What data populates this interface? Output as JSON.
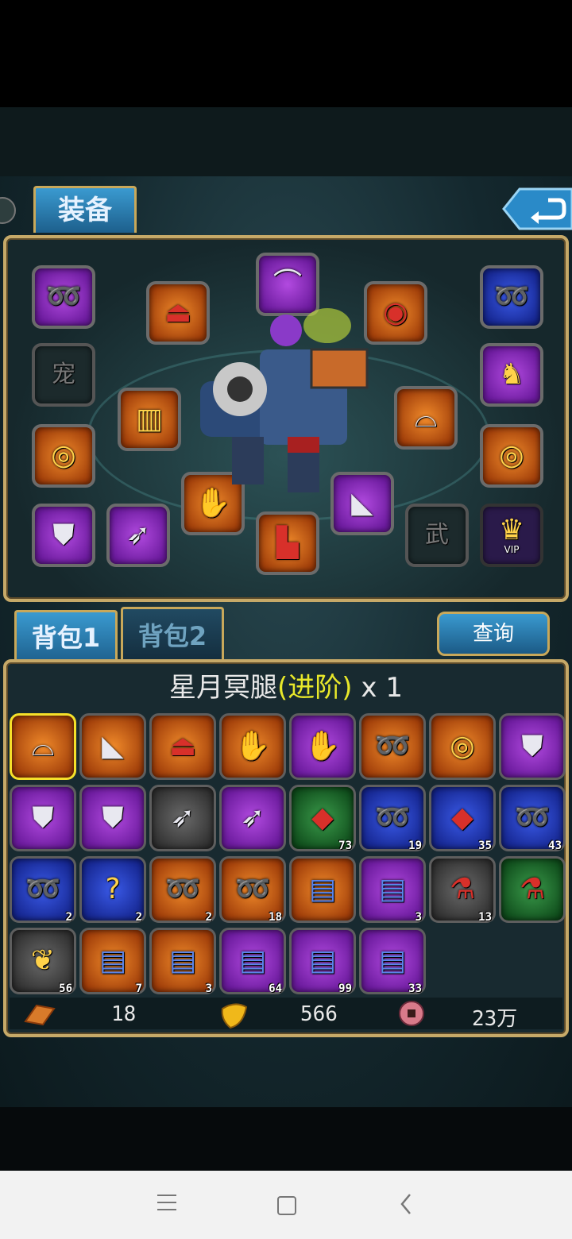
{
  "header": {
    "equip_tab": "装备",
    "back_icon": "back-arrow-icon"
  },
  "equipment_slots": [
    {
      "name": "necklace",
      "icon": "chain-amulet-icon",
      "rarity": "purple"
    },
    {
      "name": "pet",
      "label": "宠",
      "icon": "empty-slot-icon",
      "rarity": "empty"
    },
    {
      "name": "ring",
      "icon": "gold-ring-icon",
      "rarity": "orange"
    },
    {
      "name": "armor",
      "icon": "chest-armor-icon",
      "rarity": "purple"
    },
    {
      "name": "weapon",
      "icon": "spear-icon",
      "rarity": "purple"
    },
    {
      "name": "cloak",
      "icon": "red-cloak-icon",
      "rarity": "orange"
    },
    {
      "name": "bracer",
      "icon": "bracer-icon",
      "rarity": "orange"
    },
    {
      "name": "helmet",
      "icon": "winged-helm-icon",
      "rarity": "purple"
    },
    {
      "name": "gloves",
      "icon": "gauntlet-icon",
      "rarity": "orange"
    },
    {
      "name": "boots",
      "icon": "boot-icon",
      "rarity": "orange"
    },
    {
      "name": "belt",
      "icon": "belt-icon",
      "rarity": "orange"
    },
    {
      "name": "legs",
      "icon": "leg-armor-icon",
      "rarity": "orange"
    },
    {
      "name": "shoulder",
      "icon": "horn-shoulder-icon",
      "rarity": "purple"
    },
    {
      "name": "necklace2",
      "icon": "chain-amulet-icon",
      "rarity": "blue"
    },
    {
      "name": "mount",
      "icon": "horse-icon",
      "rarity": "purple"
    },
    {
      "name": "ring2",
      "icon": "gold-ring-icon",
      "rarity": "orange"
    },
    {
      "name": "weapon2",
      "label": "武",
      "icon": "empty-slot-icon",
      "rarity": "empty"
    },
    {
      "name": "vip",
      "label": "VIP",
      "icon": "crown-icon",
      "rarity": "dark"
    }
  ],
  "bag": {
    "tab1": "背包1",
    "tab2": "背包2",
    "query_button": "查询",
    "item_name": "星月冥腿",
    "item_tag": "(进阶)",
    "item_qty": "x 1",
    "rows": [
      [
        {
          "icon": "leg-armor-icon",
          "rarity": "orange",
          "count": ""
        },
        {
          "icon": "horn-shoulder-icon",
          "rarity": "orange",
          "count": ""
        },
        {
          "icon": "red-cloak-icon",
          "rarity": "orange",
          "count": ""
        },
        {
          "icon": "gauntlet-icon",
          "rarity": "orange",
          "count": ""
        },
        {
          "icon": "gauntlet-icon",
          "rarity": "purple",
          "count": ""
        },
        {
          "icon": "chain-amulet-icon",
          "rarity": "orange",
          "count": ""
        },
        {
          "icon": "gold-ring-icon",
          "rarity": "orange",
          "count": ""
        },
        {
          "icon": "chest-armor-icon",
          "rarity": "purple",
          "count": ""
        }
      ],
      [
        {
          "icon": "chest-armor-icon",
          "rarity": "purple",
          "count": ""
        },
        {
          "icon": "chest-armor-icon",
          "rarity": "purple",
          "count": ""
        },
        {
          "icon": "spear-icon",
          "rarity": "gray",
          "count": ""
        },
        {
          "icon": "spear-icon",
          "rarity": "purple",
          "count": ""
        },
        {
          "icon": "red-gem-icon",
          "rarity": "green",
          "count": "73"
        },
        {
          "icon": "chain-amulet-icon",
          "rarity": "blue",
          "count": "19"
        },
        {
          "icon": "red-gem-icon",
          "rarity": "blue",
          "count": "35"
        },
        {
          "icon": "chain-amulet-icon",
          "rarity": "blue",
          "count": "43"
        }
      ],
      [
        {
          "icon": "chain-amulet-icon",
          "rarity": "blue",
          "count": "2"
        },
        {
          "icon": "question-mark-icon",
          "rarity": "blue",
          "count": "2"
        },
        {
          "icon": "chain-amulet-icon",
          "rarity": "orange",
          "count": "2"
        },
        {
          "icon": "chain-amulet-icon",
          "rarity": "orange",
          "count": "18"
        },
        {
          "icon": "blue-book-icon",
          "rarity": "orange",
          "count": ""
        },
        {
          "icon": "blue-book-icon",
          "rarity": "purple",
          "count": "3"
        },
        {
          "icon": "red-potion-icon",
          "rarity": "gray",
          "count": "13"
        },
        {
          "icon": "red-potion-icon",
          "rarity": "green",
          "count": ""
        }
      ],
      [
        {
          "icon": "herb-icon",
          "rarity": "gray",
          "count": "56"
        },
        {
          "icon": "blue-book-icon",
          "rarity": "orange",
          "count": "7"
        },
        {
          "icon": "blue-book-icon",
          "rarity": "orange",
          "count": "3"
        },
        {
          "icon": "blue-book-icon",
          "rarity": "purple",
          "count": "64"
        },
        {
          "icon": "blue-book-icon",
          "rarity": "purple",
          "count": "99"
        },
        {
          "icon": "blue-book-icon",
          "rarity": "purple",
          "count": "33"
        }
      ]
    ]
  },
  "currency": [
    {
      "icon": "gold-ingot-icon",
      "value": "18"
    },
    {
      "icon": "gold-leaf-icon",
      "value": "566"
    },
    {
      "icon": "copper-coin-icon",
      "value": "23万"
    }
  ],
  "navbar": {
    "menu_icon": "menu-icon",
    "home_icon": "home-square-icon",
    "back_icon": "back-chevron-icon"
  }
}
